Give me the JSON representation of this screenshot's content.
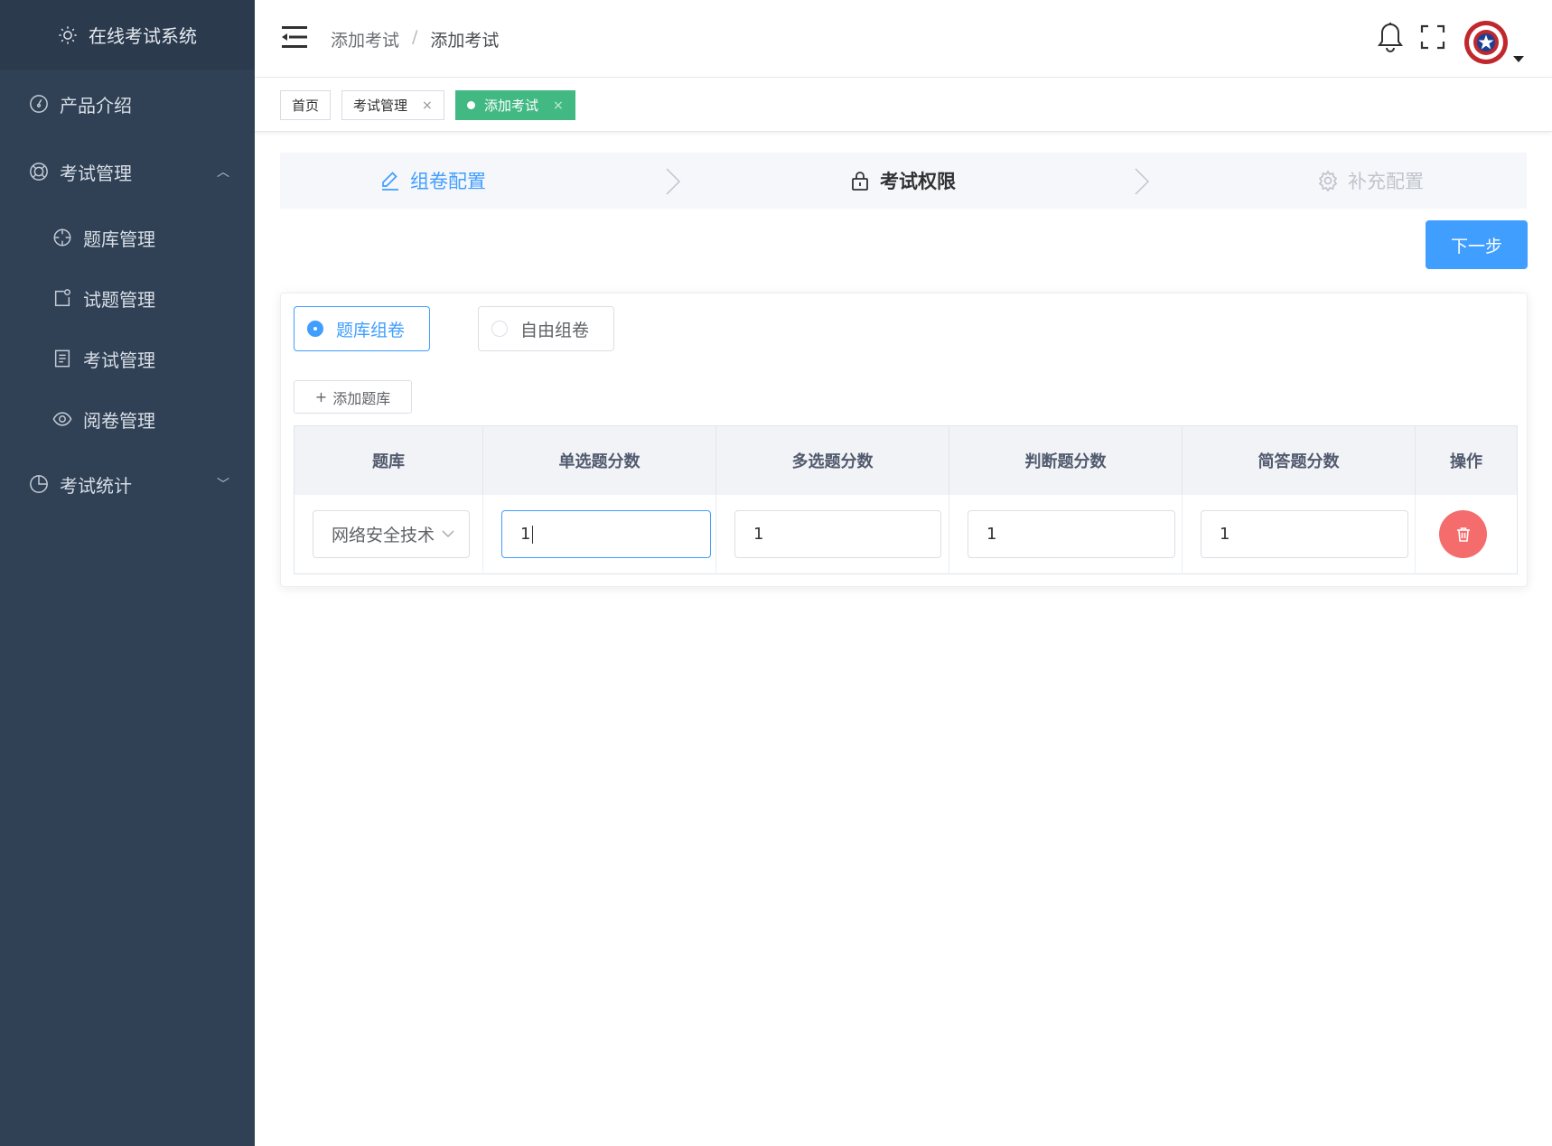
{
  "app": {
    "title": "在线考试系统"
  },
  "sidebar": {
    "items": [
      {
        "label": "产品介绍",
        "icon": "gauge-icon"
      },
      {
        "label": "考试管理",
        "icon": "lifebuoy-icon",
        "expanded": true
      },
      {
        "label": "考试统计",
        "icon": "pie-chart-icon",
        "expanded": false
      }
    ],
    "sub_items": [
      {
        "label": "题库管理",
        "icon": "target-icon"
      },
      {
        "label": "试题管理",
        "icon": "edit-box-icon"
      },
      {
        "label": "考试管理",
        "icon": "document-icon"
      },
      {
        "label": "阅卷管理",
        "icon": "eye-icon"
      }
    ]
  },
  "header": {
    "breadcrumb": [
      "添加考试",
      "添加考试"
    ],
    "separator": "/"
  },
  "tags": [
    {
      "label": "首页"
    },
    {
      "label": "考试管理",
      "close": "×"
    },
    {
      "label": "添加考试",
      "close": "×",
      "active": true
    }
  ],
  "steps": [
    {
      "label": "组卷配置",
      "state": "done"
    },
    {
      "label": "考试权限",
      "state": "active"
    },
    {
      "label": "补充配置",
      "state": "todo"
    }
  ],
  "next_button": "下一步",
  "mode": {
    "options": [
      "题库组卷",
      "自由组卷"
    ],
    "selected": "题库组卷"
  },
  "add_bank_button": "添加题库",
  "table": {
    "headers": [
      "题库",
      "单选题分数",
      "多选题分数",
      "判断题分数",
      "简答题分数",
      "操作"
    ],
    "rows": [
      {
        "bank": "网络安全技术",
        "single": "1",
        "multiple": "1",
        "judge": "1",
        "short": "1"
      }
    ]
  },
  "colors": {
    "sidebar_bg": "#304156",
    "primary": "#409eff",
    "tag_active": "#42b983",
    "danger": "#f56c6c"
  }
}
